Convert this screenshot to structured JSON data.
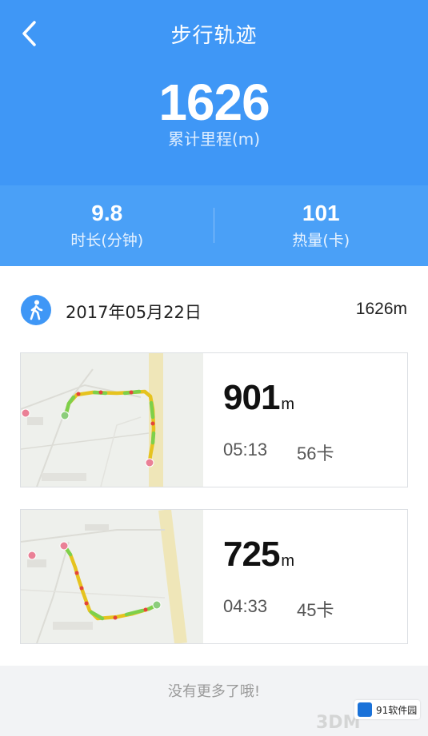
{
  "header": {
    "title": "步行轨迹",
    "total_distance": "1626",
    "total_label": "累计里程(m)",
    "bg_color": "#3f97f6"
  },
  "stats": [
    {
      "value": "9.8",
      "label": "时长(分钟)"
    },
    {
      "value": "101",
      "label": "热量(卡)"
    }
  ],
  "day": {
    "date": "2017年05月22日",
    "distance": "1626m",
    "icon": "walking-person-icon"
  },
  "records": [
    {
      "distance": "901",
      "unit": "m",
      "duration": "05:13",
      "calories": "56卡"
    },
    {
      "distance": "725",
      "unit": "m",
      "duration": "04:33",
      "calories": "45卡"
    }
  ],
  "footer": {
    "text": "没有更多了哦!",
    "watermark_site": "91软件园",
    "watermark_text": "3DM"
  }
}
